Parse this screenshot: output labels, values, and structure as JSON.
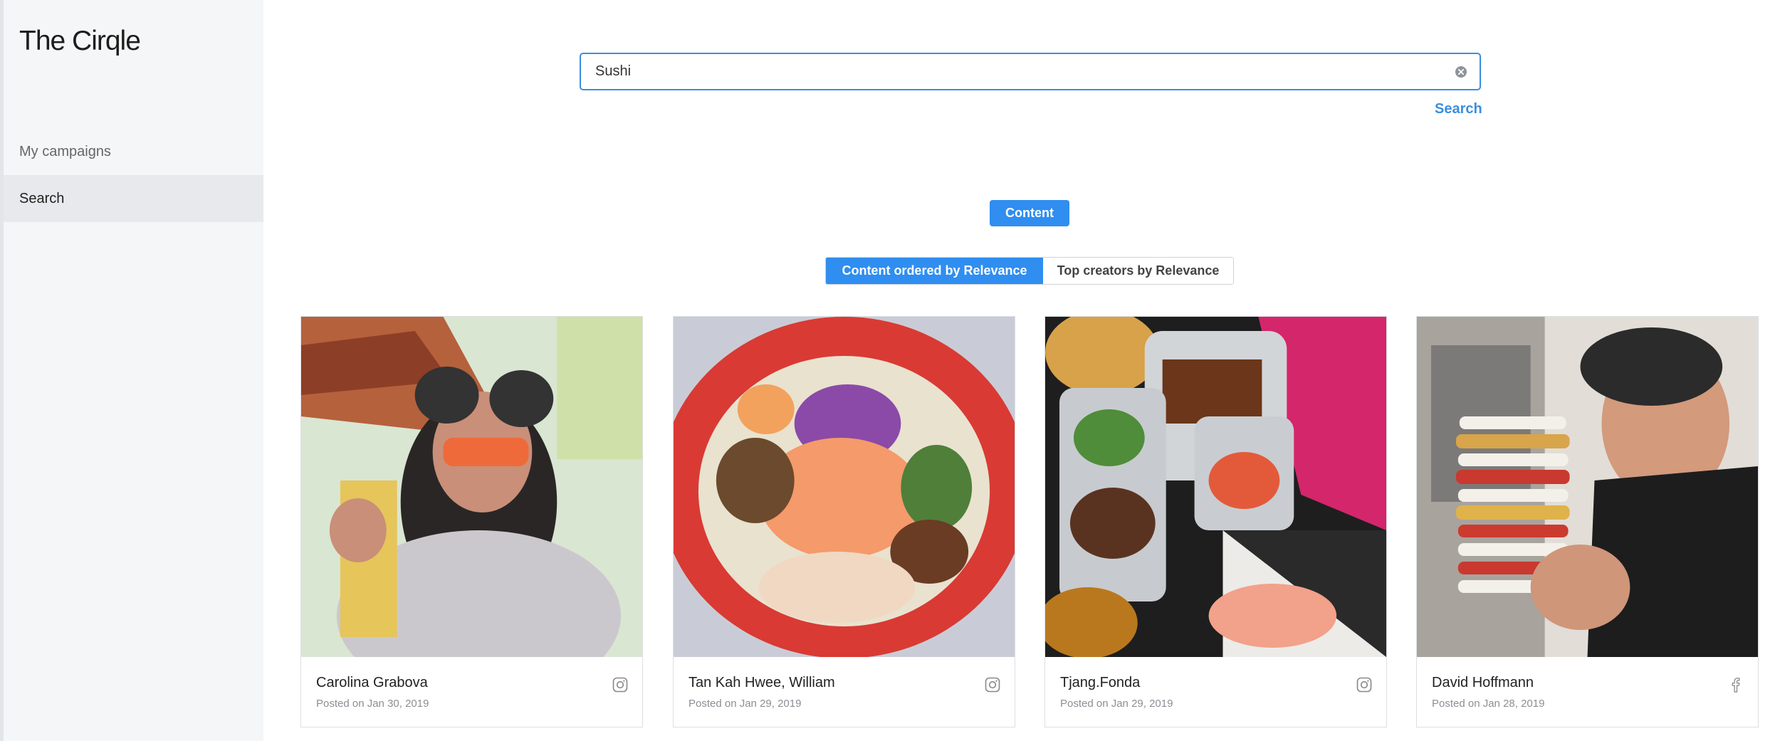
{
  "app": {
    "brand": "The Cirqle"
  },
  "sidebar": {
    "items": [
      {
        "label": "My campaigns",
        "active": false
      },
      {
        "label": "Search",
        "active": true
      }
    ]
  },
  "search": {
    "value": "Sushi",
    "clear_icon": "clear-circle-icon",
    "submit_label": "Search"
  },
  "filters": {
    "content_label": "Content",
    "tabs": [
      {
        "label": "Content ordered by Relevance",
        "active": true
      },
      {
        "label": "Top creators by Relevance",
        "active": false
      }
    ]
  },
  "colors": {
    "accent": "#2f8ef0",
    "link": "#3b8ede"
  },
  "results": [
    {
      "creator": "Carolina Grabova",
      "posted": "Posted on Jan 30, 2019",
      "network": "instagram-icon"
    },
    {
      "creator": "Tan Kah Hwee, William",
      "posted": "Posted on Jan 29, 2019",
      "network": "instagram-icon"
    },
    {
      "creator": "Tjang.Fonda",
      "posted": "Posted on Jan 29, 2019",
      "network": "instagram-icon"
    },
    {
      "creator": "David Hoffmann",
      "posted": "Posted on Jan 28, 2019",
      "network": "facebook-icon"
    }
  ]
}
